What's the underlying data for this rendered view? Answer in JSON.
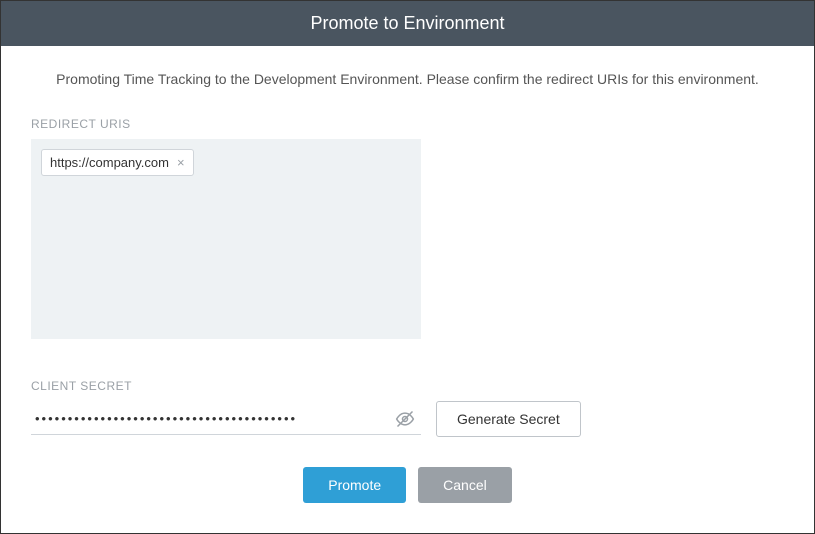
{
  "header": {
    "title": "Promote to Environment"
  },
  "description": "Promoting Time Tracking to the Development Environment. Please confirm the redirect URIs for this environment.",
  "redirect": {
    "label": "REDIRECT URIS",
    "chips": [
      {
        "value": "https://company.com"
      }
    ]
  },
  "secret": {
    "label": "CLIENT SECRET",
    "masked_value": "••••••••••••••••••••••••••••••••••••••••",
    "generate_label": "Generate Secret"
  },
  "footer": {
    "primary_label": "Promote",
    "secondary_label": "Cancel"
  }
}
